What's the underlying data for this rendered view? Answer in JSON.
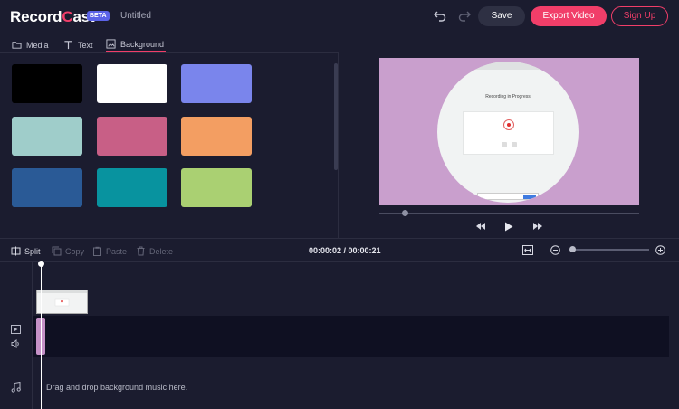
{
  "header": {
    "logo_left": "Record",
    "logo_right": "ast",
    "logo_mark": "C",
    "beta": "BETA",
    "doc_title": "Untitled",
    "save": "Save",
    "export": "Export Video",
    "signup": "Sign Up"
  },
  "tabs": [
    {
      "label": "Media",
      "icon": "folder-icon"
    },
    {
      "label": "Text",
      "icon": "text-icon"
    },
    {
      "label": "Background",
      "icon": "background-icon",
      "active": true
    }
  ],
  "backgrounds": [
    "#000000",
    "#ffffff",
    "#7a85ec",
    "#9fcdca",
    "#c85f86",
    "#f39e62",
    "#2a5a96",
    "#08939f",
    "#aad072"
  ],
  "preview": {
    "background_color": "#c99fcd",
    "screen_title": "Recording in Progress"
  },
  "toolbar": {
    "split": "Split",
    "copy": "Copy",
    "paste": "Paste",
    "delete": "Delete",
    "timecode": "00:00:02 / 00:00:21"
  },
  "timeline": {
    "music_hint": "Drag and drop background music here."
  }
}
